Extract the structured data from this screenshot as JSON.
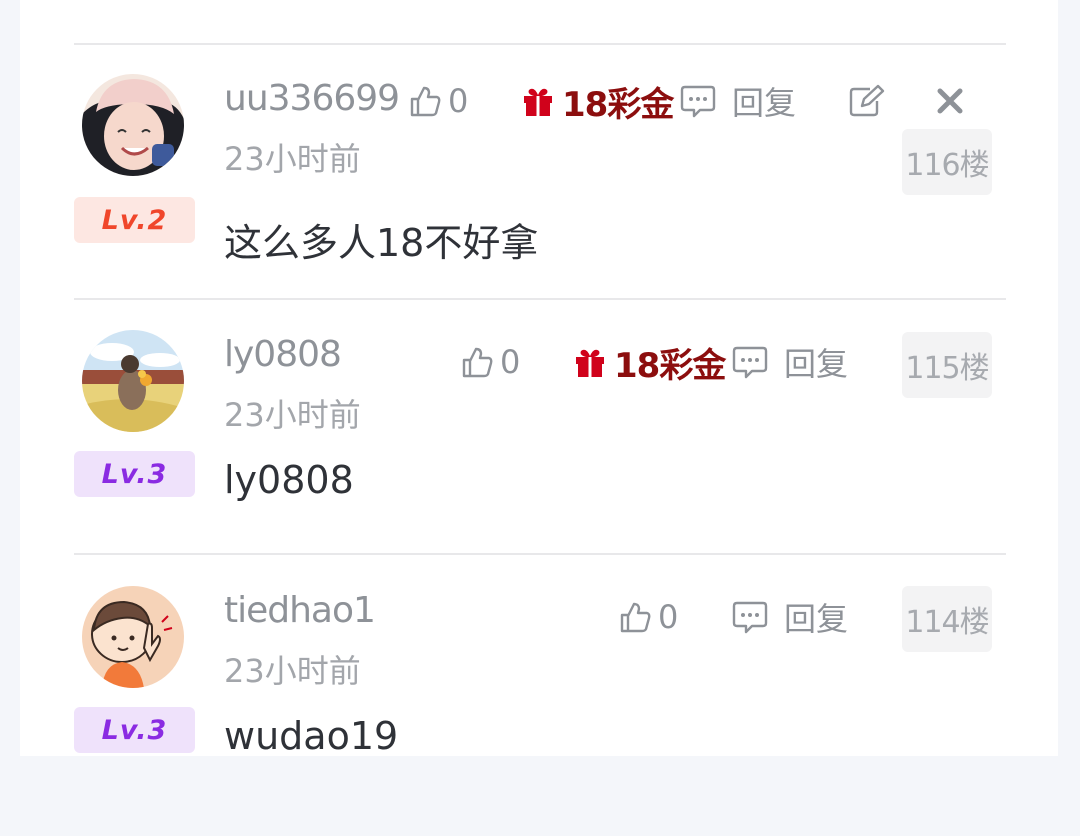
{
  "comments": [
    {
      "username": "uu336699",
      "time": "23小时前",
      "level": "Lv.2",
      "content": "这么多人18不好拿",
      "likes": "0",
      "gift": "18彩金",
      "reply_label": "回复",
      "floor": "116楼",
      "has_edit": true,
      "has_delete": true
    },
    {
      "username": "ly0808",
      "time": "23小时前",
      "level": "Lv.3",
      "content": "ly0808",
      "likes": "0",
      "gift": "18彩金",
      "reply_label": "回复",
      "floor": "115楼"
    },
    {
      "username": "tiedhao1",
      "time": "23小时前",
      "level": "Lv.3",
      "content": "wudao19",
      "likes": "0",
      "reply_label": "回复",
      "floor": "114楼"
    }
  ],
  "colors": {
    "gift": "#8c0e0e",
    "gift_icon": "#d0021b",
    "lv2_text": "#f0462b",
    "lv3_text": "#8a2be2"
  },
  "icons": [
    "thumb-up-icon",
    "gift-icon",
    "comment-icon",
    "edit-icon",
    "close-icon"
  ]
}
